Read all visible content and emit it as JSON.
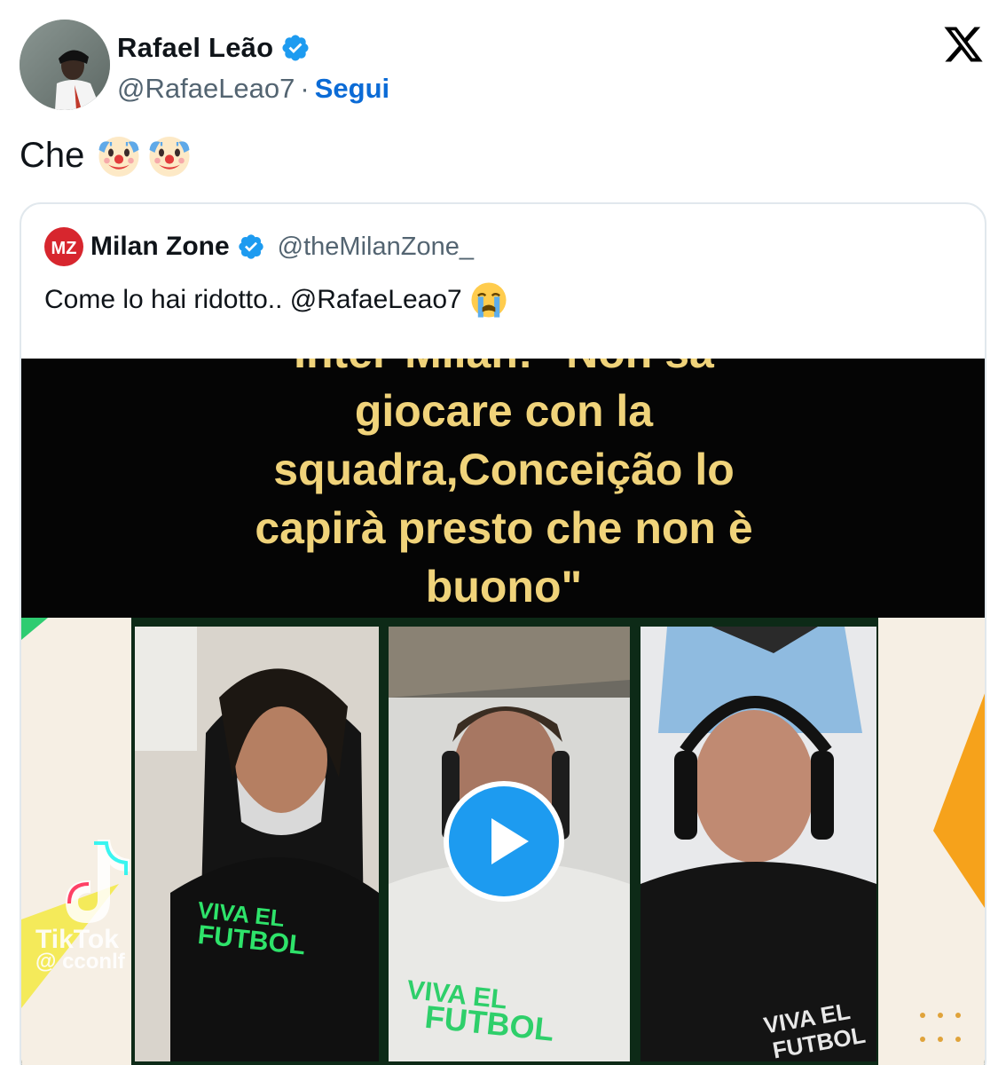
{
  "author": {
    "display_name": "Rafael Leão",
    "handle": "@RafaeLeao7",
    "separator": "·",
    "follow_label": "Segui"
  },
  "tweet": {
    "text": "Che",
    "emojis": [
      "clown-face",
      "clown-face"
    ]
  },
  "quoted_tweet": {
    "display_name": "Milan Zone",
    "handle": "@theMilanZone_",
    "text": "Come lo hai ridotto.. @RafaeLeao7",
    "emoji": "loudly-crying-face",
    "video": {
      "caption_lines": [
        "Inter-Milan: \"Non sa",
        "giocare con la",
        "squadra,Conceição lo",
        "capirà presto che non è",
        "buono\""
      ],
      "watermark_brand": "TikTok",
      "watermark_user": "@ cconlf",
      "shirt_text": "VIVA EL FUTBOL"
    }
  },
  "colors": {
    "verified": "#1d9bf0",
    "follow": "#0b6bd6",
    "caption": "#f0d37a",
    "play": "#1d9bf0"
  }
}
